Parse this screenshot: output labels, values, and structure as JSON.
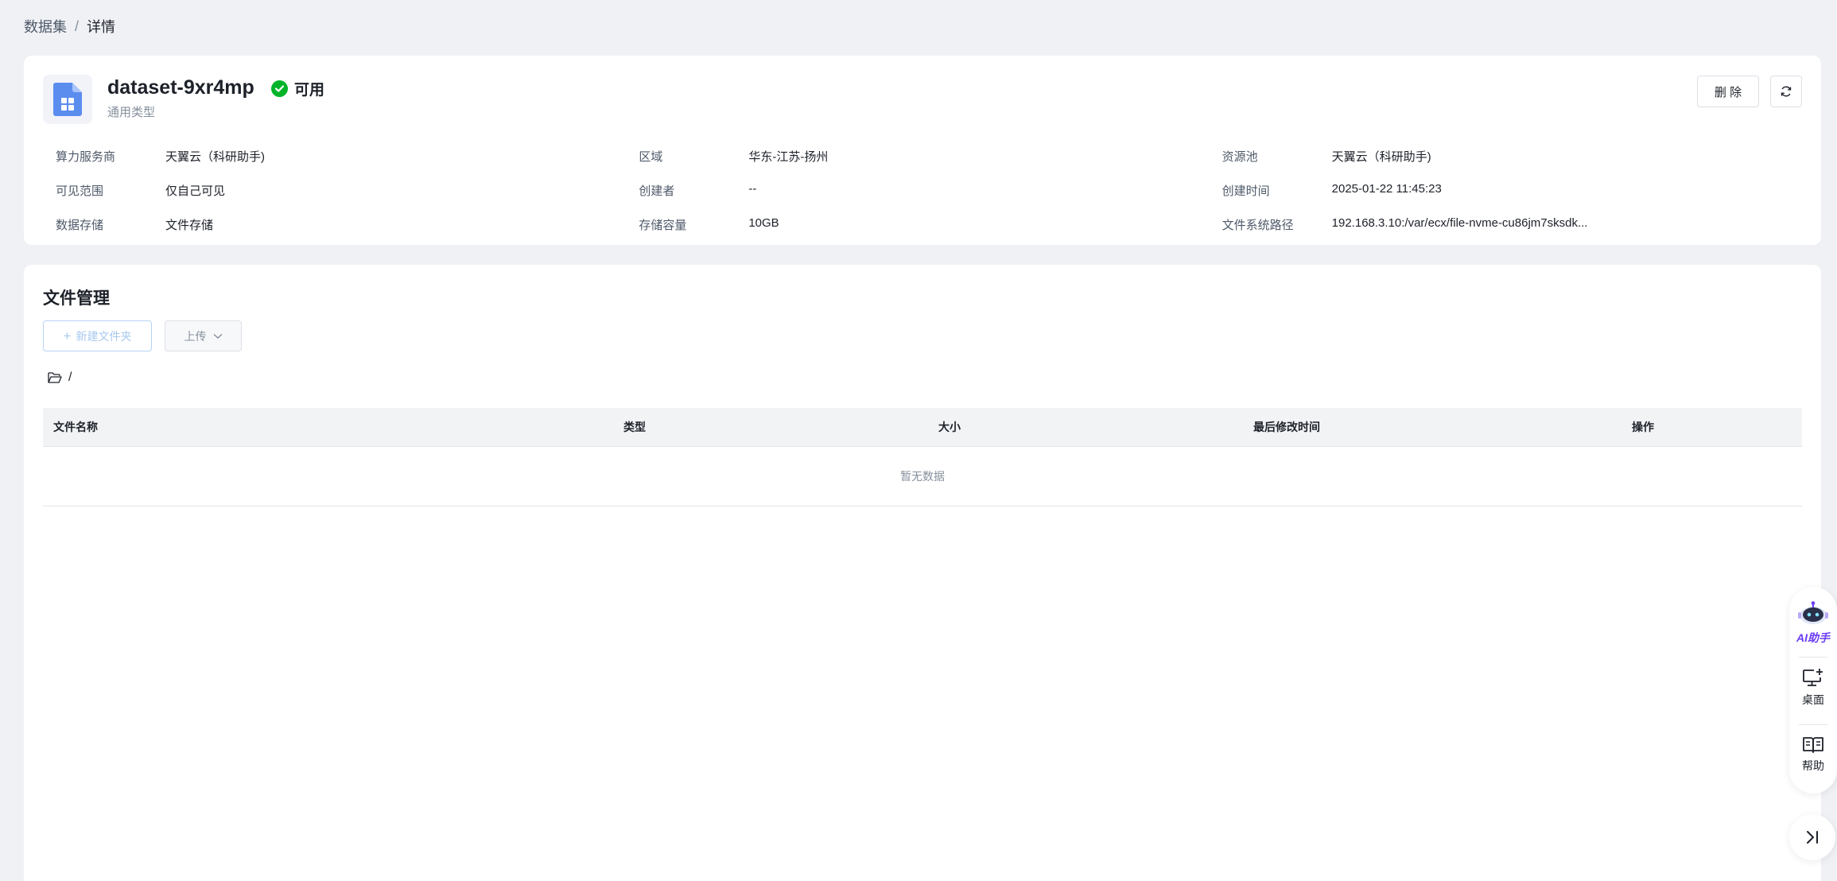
{
  "breadcrumb": {
    "parent": "数据集",
    "separator": "/",
    "current": "详情"
  },
  "dataset": {
    "name": "dataset-9xr4mp",
    "status": "可用",
    "type": "通用类型",
    "status_color": "#00b42a"
  },
  "actions": {
    "delete_label": "删 除",
    "refresh_icon": "refresh-icon"
  },
  "meta": [
    [
      {
        "label": "算力服务商",
        "value": "天翼云（科研助手)"
      },
      {
        "label": "区域",
        "value": "华东-江苏-扬州"
      },
      {
        "label": "资源池",
        "value": "天翼云（科研助手)"
      }
    ],
    [
      {
        "label": "可见范围",
        "value": "仅自己可见"
      },
      {
        "label": "创建者",
        "value": "--"
      },
      {
        "label": "创建时间",
        "value": "2025-01-22 11:45:23"
      }
    ],
    [
      {
        "label": "数据存储",
        "value": "文件存储"
      },
      {
        "label": "存储容量",
        "value": "10GB"
      },
      {
        "label": "文件系统路径",
        "value": "192.168.3.10:/var/ecx/file-nvme-cu86jm7sksdk..."
      }
    ]
  ],
  "files": {
    "title": "文件管理",
    "new_folder_label": "新建文件夹",
    "upload_label": "上传",
    "path": "/",
    "columns": [
      "文件名称",
      "类型",
      "大小",
      "最后修改时间",
      "操作"
    ],
    "empty_text": "暂无数据"
  },
  "float_bar": {
    "ai_label": "AI助手",
    "desktop_label": "桌面",
    "help_label": "帮助"
  },
  "colors": {
    "accent": "#1664ff",
    "ai_purple": "#6a3df5",
    "background": "#eff1f5"
  }
}
